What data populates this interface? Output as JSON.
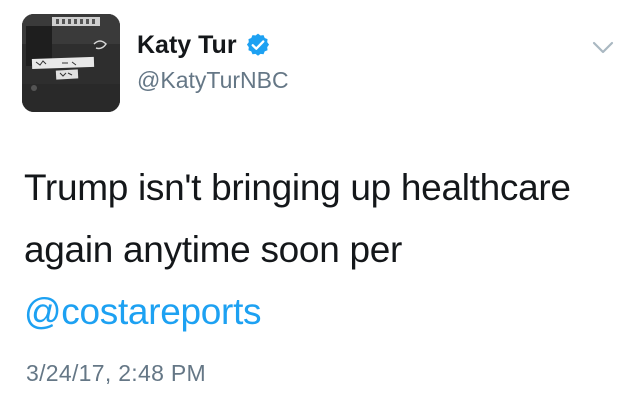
{
  "tweet": {
    "display_name": "Katy Tur",
    "handle": "@KatyTurNBC",
    "text_before": "Trump isn't bringing up healthcare again anytime soon per ",
    "mention": "@costareports",
    "timestamp": "3/24/17, 2:48 PM",
    "verified": true
  },
  "colors": {
    "text": "#14171a",
    "secondary": "#657786",
    "link": "#1da1f2",
    "verified_badge": "#1da1f2"
  },
  "icons": {
    "verified": "verified-badge-icon",
    "menu": "chevron-down-icon"
  }
}
